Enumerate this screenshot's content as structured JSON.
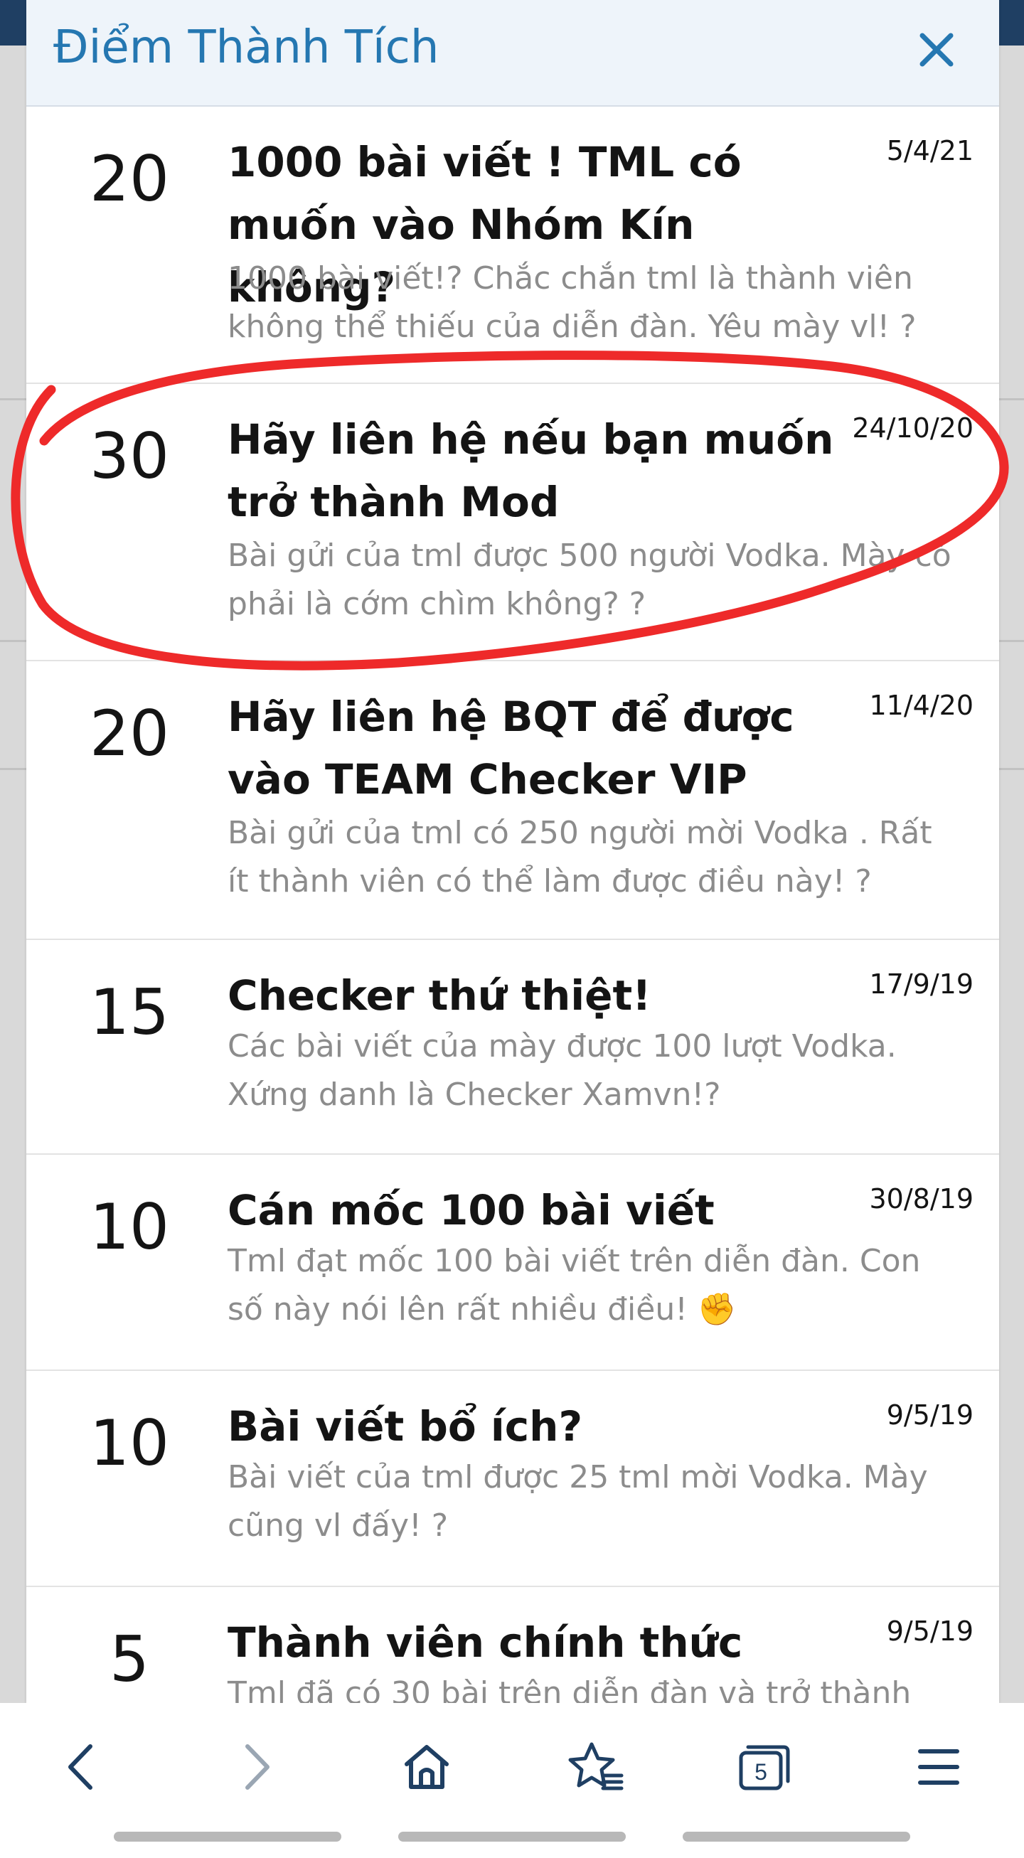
{
  "modal": {
    "title": "Điểm Thành Tích",
    "close_icon": "close-icon"
  },
  "achievements": [
    {
      "points": "20",
      "title": "1000 bài viết ! TML có muốn vào Nhóm Kín không?",
      "date": "5/4/21",
      "description": "1000 bài viết!? Chắc chắn tml là thành viên không thể thiếu của diễn đàn. Yêu mày vl! ?"
    },
    {
      "points": "30",
      "title": "Hãy liên hệ nếu bạn muốn trở thành Mod",
      "date": "24/10/20",
      "description": "Bài gửi của tml được 500 người Vodka. Mày có phải là cớm chìm không? ?"
    },
    {
      "points": "20",
      "title": "Hãy liên hệ BQT để được vào TEAM Checker VIP",
      "date": "11/4/20",
      "description": "Bài gửi của tml có 250 người mời Vodka . Rất ít thành viên có thể làm được điều này! ?"
    },
    {
      "points": "15",
      "title": "Checker thứ thiệt!",
      "date": "17/9/19",
      "description": "Các bài viết của mày được 100 lượt Vodka. Xứng danh là Checker Xamvn!?"
    },
    {
      "points": "10",
      "title": "Cán mốc 100 bài viết",
      "date": "30/8/19",
      "description": "Tml đạt mốc 100 bài viết trên diễn đàn. Con số này nói lên rất nhiều điều! ✊"
    },
    {
      "points": "10",
      "title": "Bài viết bổ ích?",
      "date": "9/5/19",
      "description": "Bài viết của tml được 25 tml mời Vodka. Mày cũng vl đấy! ?"
    },
    {
      "points": "5",
      "title": "Thành viên chính thức",
      "date": "9/5/19",
      "description": "Tml đã có 30 bài trên diễn đàn và trở thành"
    }
  ],
  "toolbar": {
    "tabs_count": "5",
    "icons": [
      "back-icon",
      "forward-icon",
      "home-icon",
      "bookmarks-icon",
      "tabs-icon",
      "menu-icon"
    ]
  },
  "colors": {
    "title_blue": "#2577b1",
    "annotation_red": "#ee2a2a",
    "muted_text": "#8c8c8c"
  }
}
